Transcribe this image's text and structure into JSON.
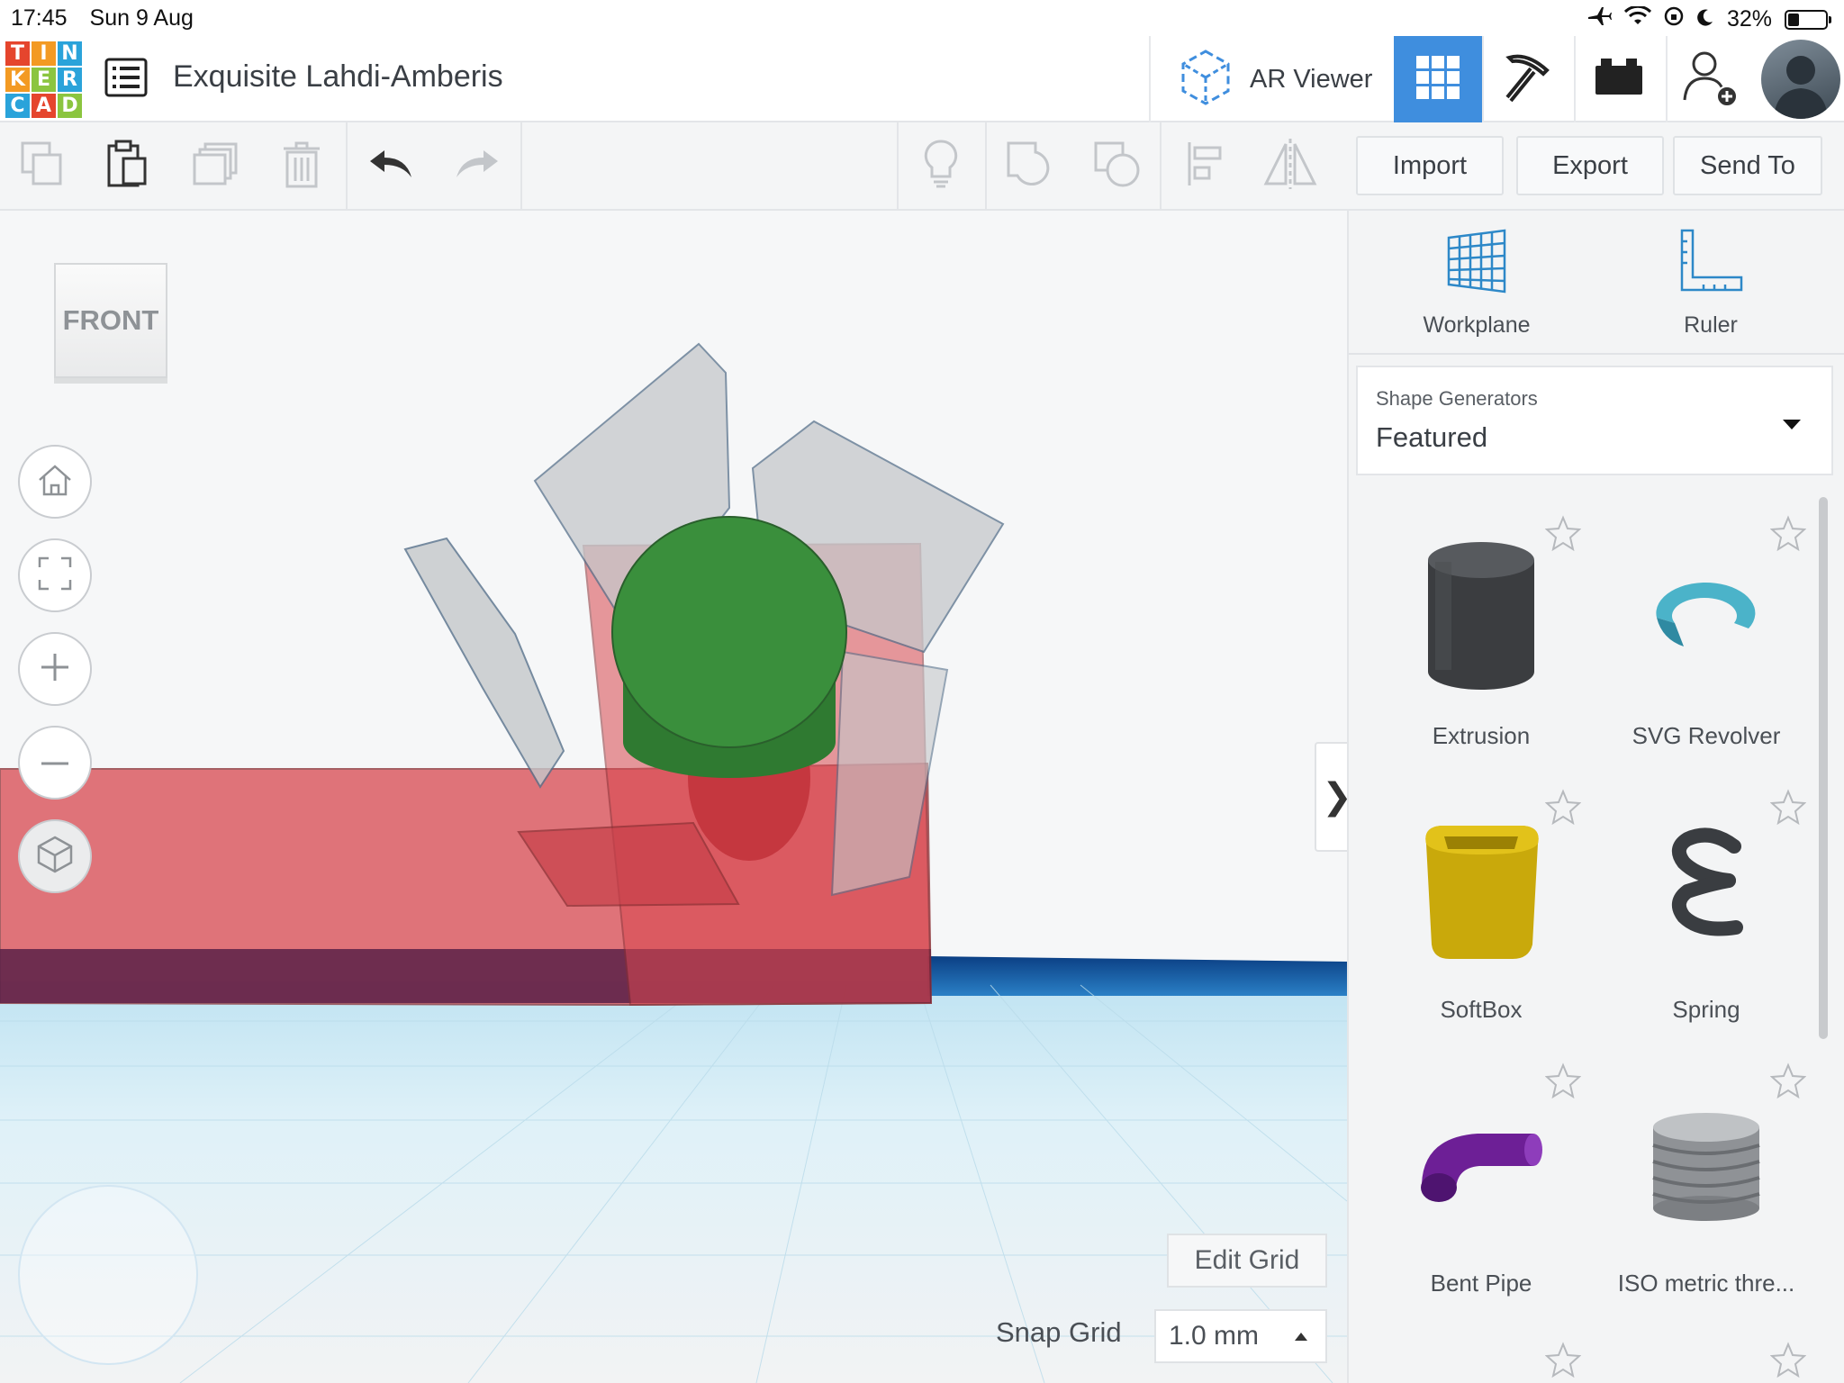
{
  "status_bar": {
    "time": "17:45",
    "date": "Sun 9 Aug",
    "battery": "32%"
  },
  "header": {
    "logo_letters": [
      "T",
      "I",
      "N",
      "K",
      "E",
      "R",
      "C",
      "A",
      "D"
    ],
    "logo_colors": [
      "#e5452d",
      "#f39a23",
      "#2aa3da",
      "#f39a23",
      "#8bc53f",
      "#2aa3da",
      "#2aa3da",
      "#e5452d",
      "#8bc53f"
    ],
    "doc_title": "Exquisite Lahdi-Amberis",
    "ar_viewer_label": "AR Viewer"
  },
  "toolbar": {
    "import_label": "Import",
    "export_label": "Export",
    "send_to_label": "Send To"
  },
  "canvas": {
    "view_cube_label": "FRONT",
    "edit_grid_label": "Edit Grid",
    "snap_grid_label": "Snap Grid",
    "snap_grid_value": "1.0 mm",
    "collapse_glyph": "❯"
  },
  "panel": {
    "tools": [
      {
        "label": "Workplane",
        "icon": "workplane-icon"
      },
      {
        "label": "Ruler",
        "icon": "ruler-icon"
      }
    ],
    "shape_generators_label": "Shape Generators",
    "shape_generators_value": "Featured",
    "shapes": [
      {
        "name": "Extrusion"
      },
      {
        "name": "SVG Revolver"
      },
      {
        "name": "SoftBox"
      },
      {
        "name": "Spring"
      },
      {
        "name": "Bent Pipe"
      },
      {
        "name": "ISO metric thre..."
      }
    ]
  },
  "colors": {
    "accent_blue": "#3f8ede",
    "shape_red": "#d8474f",
    "shape_green": "#3a8f3c"
  }
}
